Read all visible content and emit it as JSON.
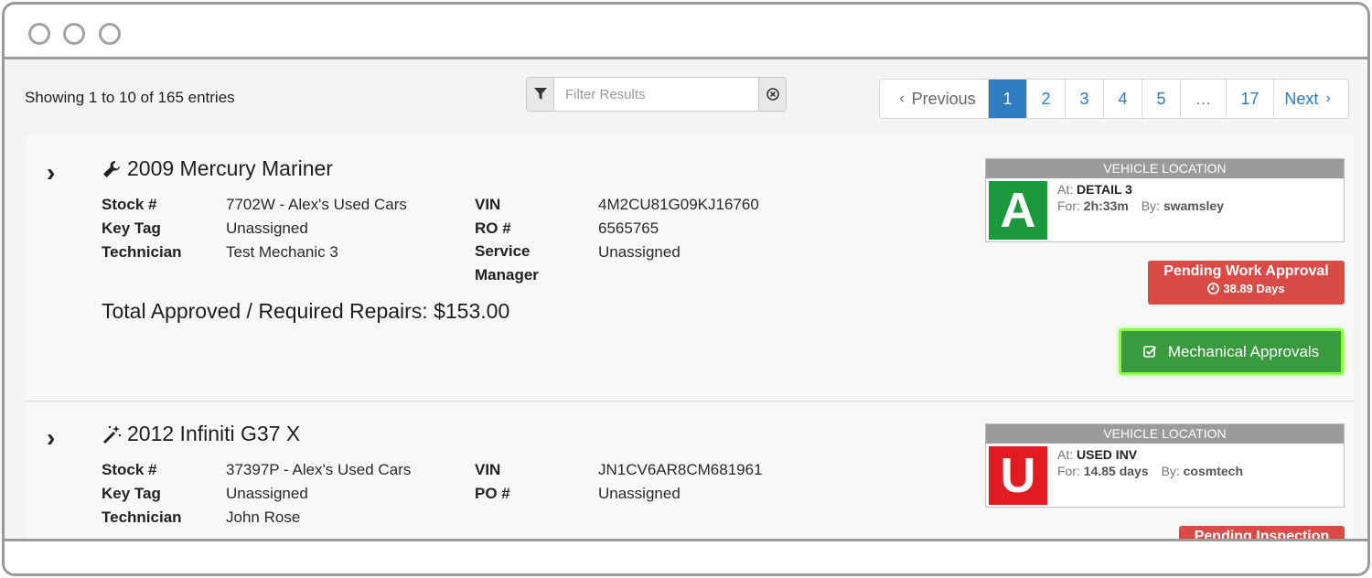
{
  "list": {
    "showing_text": "Showing 1 to 10 of 165 entries"
  },
  "filter": {
    "placeholder": "Filter Results",
    "value": ""
  },
  "pagination": {
    "previous": "Previous",
    "pages": [
      "1",
      "2",
      "3",
      "4",
      "5",
      "…",
      "17"
    ],
    "active": "1",
    "next": "Next"
  },
  "vehicles": [
    {
      "title": "2009 Mercury Mariner",
      "icon": "wrench-icon",
      "fields": {
        "stock_label": "Stock #",
        "stock_value": "7702W - Alex's Used Cars",
        "keytag_label": "Key Tag",
        "keytag_value": "Unassigned",
        "technician_label": "Technician",
        "technician_value": "Test Mechanic 3",
        "vin_label": "VIN",
        "vin_value": "4M2CU81G09KJ16760",
        "order_label": "RO #",
        "order_value": "6565765",
        "service_label": "Service Manager",
        "service_value": "Unassigned"
      },
      "total": "Total Approved / Required Repairs: $153.00",
      "location": {
        "header": "VEHICLE LOCATION",
        "letter": "A",
        "color": "#1a9a3c",
        "at_label": "At:",
        "at_value": "DETAIL 3",
        "for_label": "For:",
        "for_value": "2h:33m",
        "by_label": "By:",
        "by_value": "swamsley"
      },
      "status": {
        "label": "Pending Work Approval",
        "duration": "38.89 Days",
        "color": "#db4b46"
      },
      "action": {
        "label": "Mechanical Approvals",
        "color": "#3a9a3e"
      }
    },
    {
      "title": "2012 Infiniti G37 X",
      "icon": "magic-wand-icon",
      "fields": {
        "stock_label": "Stock #",
        "stock_value": "37397P - Alex's Used Cars",
        "keytag_label": "Key Tag",
        "keytag_value": "Unassigned",
        "technician_label": "Technician",
        "technician_value": "John Rose",
        "vin_label": "VIN",
        "vin_value": "JN1CV6AR8CM681961",
        "order_label": "PO #",
        "order_value": "Unassigned"
      },
      "location": {
        "header": "VEHICLE LOCATION",
        "letter": "U",
        "color": "#e21b23",
        "at_label": "At:",
        "at_value": "USED INV",
        "for_label": "For:",
        "for_value": "14.85 days",
        "by_label": "By:",
        "by_value": "cosmtech"
      },
      "status": {
        "label": "Pending Inspection",
        "color": "#db4b46"
      }
    }
  ]
}
